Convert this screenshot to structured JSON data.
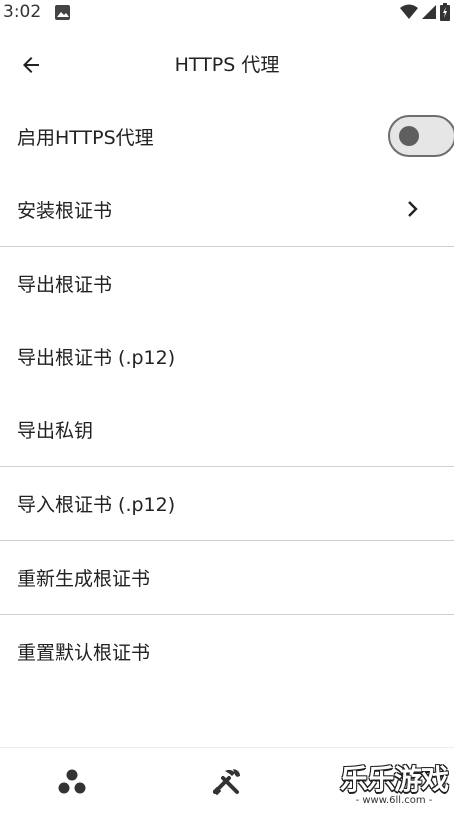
{
  "status_bar": {
    "time": "3:02"
  },
  "app_bar": {
    "title": "HTTPS 代理"
  },
  "settings": {
    "enable_https_proxy": {
      "label": "启用HTTPS代理",
      "enabled": false
    },
    "install_root_cert": {
      "label": "安装根证书"
    },
    "export_root_cert": {
      "label": "导出根证书"
    },
    "export_root_cert_p12": {
      "label": "导出根证书 (.p12)"
    },
    "export_private_key": {
      "label": "导出私钥"
    },
    "import_root_cert_p12": {
      "label": "导入根证书 (.p12)"
    },
    "regenerate_root_cert": {
      "label": "重新生成根证书"
    },
    "reset_default_root_cert": {
      "label": "重置默认根证书"
    }
  },
  "bottom_nav": {
    "items": [
      {
        "icon": "three-dots-icon"
      },
      {
        "icon": "tools-icon"
      }
    ]
  },
  "watermark": {
    "logo_text": "乐乐游戏",
    "url": "- www.6ll.com -"
  }
}
